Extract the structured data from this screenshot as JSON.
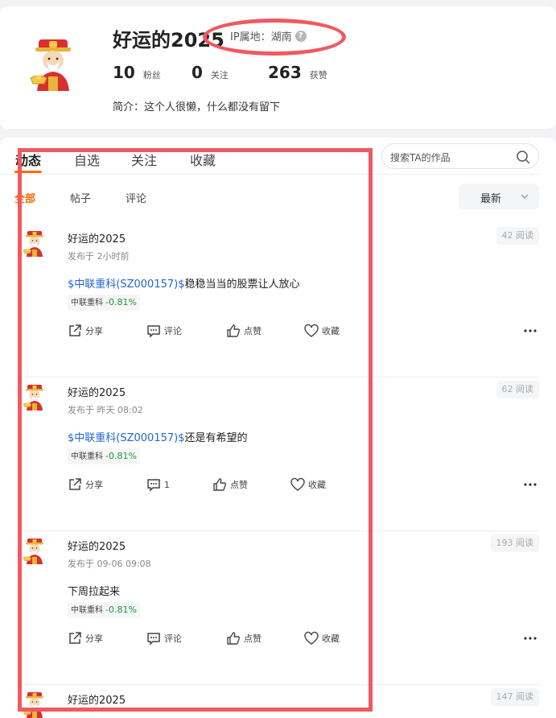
{
  "profile": {
    "name": "好运的2025",
    "ip_label": "IP属地：湖南",
    "bio": "简介：这个人很懒，什么都没有留下",
    "stats": [
      {
        "num": "10",
        "label": "粉丝"
      },
      {
        "num": "0",
        "label": "关注"
      },
      {
        "num": "263",
        "label": "获赞"
      }
    ]
  },
  "tabs": [
    {
      "label": "动态"
    },
    {
      "label": "自选"
    },
    {
      "label": "关注"
    },
    {
      "label": "收藏"
    }
  ],
  "search": {
    "placeholder": "搜索TA的作品"
  },
  "subtabs": [
    {
      "label": "全部"
    },
    {
      "label": "帖子"
    },
    {
      "label": "评论"
    }
  ],
  "sort": {
    "label": "最新"
  },
  "posts": [
    {
      "author": "好运的2025",
      "time": "发布于 2小时前",
      "reads": "42 阅读",
      "link": "$中联重科(SZ000157)$",
      "text": "稳稳当当的股票让人放心",
      "tag_name": "中联重科",
      "tag_change": "-0.81%",
      "share": "分享",
      "comment": "评论",
      "like": "点赞",
      "fav": "收藏"
    },
    {
      "author": "好运的2025",
      "time": "发布于 昨天 08:02",
      "reads": "62 阅读",
      "link": "$中联重科(SZ000157)$",
      "text": "还是有希望的",
      "tag_name": "中联重科",
      "tag_change": "-0.81%",
      "share": "分享",
      "comment": "1",
      "like": "点赞",
      "fav": "收藏"
    },
    {
      "author": "好运的2025",
      "time": "发布于 09-06 09:08",
      "reads": "193 阅读",
      "link": "",
      "text": "下周拉起来",
      "tag_name": "中联重科",
      "tag_change": "-0.81%",
      "share": "分享",
      "comment": "评论",
      "like": "点赞",
      "fav": "收藏"
    },
    {
      "author": "好运的2025",
      "reads": "147 阅读"
    }
  ],
  "colors": {
    "accent": "#ff6a00",
    "link": "#2266cc",
    "down": "#1a9a3a",
    "annotation": "#ef5a5f"
  },
  "icons": [
    "fortune-god-avatar",
    "question-icon",
    "search-icon",
    "chevron-down-icon",
    "share-icon",
    "comment-icon",
    "like-icon",
    "heart-icon",
    "more-icon"
  ]
}
